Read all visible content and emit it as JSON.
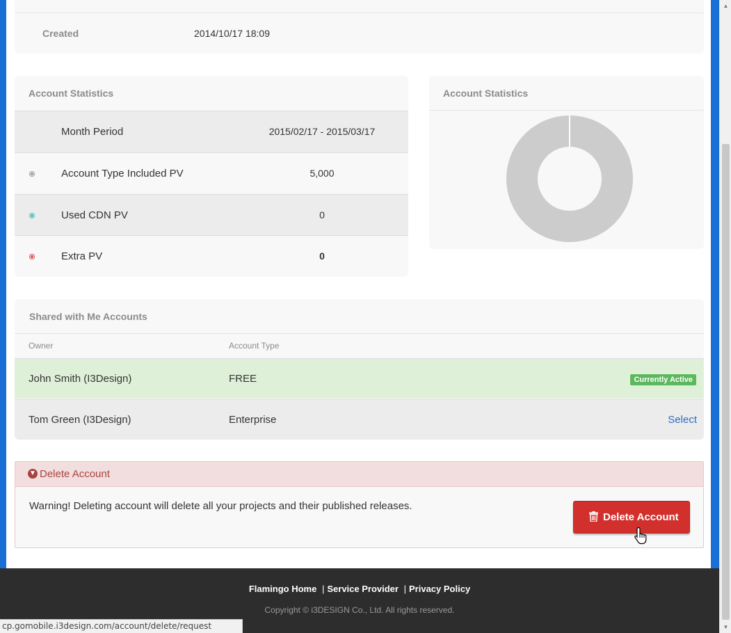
{
  "created": {
    "label": "Created",
    "value": "2014/10/17 18:09"
  },
  "stats": {
    "title": "Account Statistics",
    "rows": [
      {
        "label": "Month Period",
        "value": "2015/02/17 - 2015/03/17"
      },
      {
        "label": "Account Type Included PV",
        "value": "5,000",
        "dot_color": "#999999"
      },
      {
        "label": "Used CDN PV",
        "value": "0",
        "dot_color": "#3fbfbf"
      },
      {
        "label": "Extra PV",
        "value": "0",
        "dot_color": "#d9534f"
      }
    ]
  },
  "chart": {
    "title": "Account Statistics",
    "chart_data": {
      "type": "pie",
      "title": "",
      "categories": [
        "Account Type Included PV",
        "Used CDN PV",
        "Extra PV"
      ],
      "values": [
        5000,
        0,
        0
      ],
      "colors": [
        "#cccccc",
        "#3fbfbf",
        "#d9534f"
      ]
    }
  },
  "shared": {
    "title": "Shared with Me Accounts",
    "columns": {
      "owner": "Owner",
      "type": "Account Type"
    },
    "rows": [
      {
        "owner": "John Smith (I3Design)",
        "type": "FREE",
        "status": "Currently Active"
      },
      {
        "owner": "Tom Green (I3Design)",
        "type": "Enterprise",
        "action": "Select"
      }
    ]
  },
  "delete": {
    "title": "Delete Account",
    "warning": "Warning! Deleting account will delete all your projects and their published releases.",
    "button": "Delete Account"
  },
  "footer": {
    "links": [
      "Flamingo Home",
      "Service Provider",
      "Privacy Policy"
    ],
    "copyright": "Copyright © i3DESIGN Co., Ltd. All rights reserved."
  },
  "statusbar": "cp.gomobile.i3design.com/account/delete/request"
}
